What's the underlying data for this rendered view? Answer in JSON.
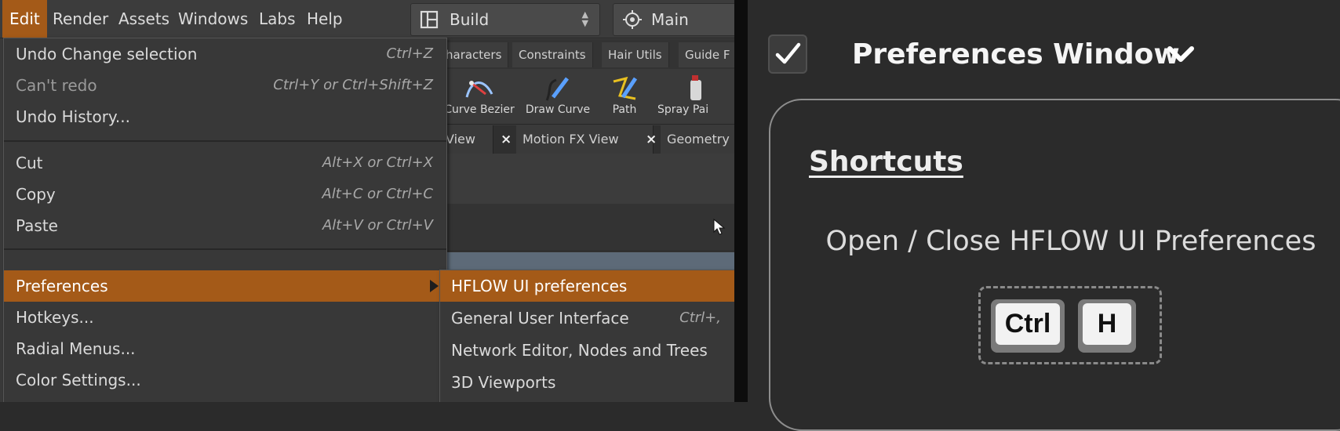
{
  "menubar": {
    "items": [
      "Edit",
      "Render",
      "Assets",
      "Windows",
      "Labs",
      "Help"
    ],
    "active": "Edit"
  },
  "desktop_selector": {
    "value": "Build",
    "icon": "layout-icon"
  },
  "main_button": {
    "label": "Main",
    "icon": "crosshair-icon"
  },
  "shelf_tabs": [
    "haracters",
    "Constraints",
    "Hair Utils",
    "Guide F"
  ],
  "shelf_tools": [
    {
      "label": "Curve Bezier",
      "icon": "curve-bezier-icon"
    },
    {
      "label": "Draw Curve",
      "icon": "draw-curve-icon"
    },
    {
      "label": "Path",
      "icon": "path-icon"
    },
    {
      "label": "Spray Pai",
      "icon": "spray-paint-icon"
    }
  ],
  "pane_tabs": [
    "View",
    "Motion FX View",
    "Geometry"
  ],
  "edit_menu": {
    "items": [
      {
        "label": "Undo Change selection",
        "shortcut": "Ctrl+Z"
      },
      {
        "label": "Can't redo",
        "shortcut": "Ctrl+Y or Ctrl+Shift+Z"
      },
      {
        "label": "Undo History...",
        "shortcut": ""
      },
      {
        "label": "Cut",
        "shortcut": "Alt+X or Ctrl+X"
      },
      {
        "label": "Copy",
        "shortcut": "Alt+C or Ctrl+C"
      },
      {
        "label": "Paste",
        "shortcut": "Alt+V or Ctrl+V"
      },
      {
        "label": "Preferences",
        "shortcut": ""
      },
      {
        "label": "Hotkeys...",
        "shortcut": ""
      },
      {
        "label": "Radial Menus...",
        "shortcut": ""
      },
      {
        "label": "Color Settings...",
        "shortcut": ""
      }
    ],
    "highlighted": "Preferences",
    "disabled": "Can't redo"
  },
  "preferences_submenu": {
    "items": [
      {
        "label": "HFLOW UI preferences",
        "shortcut": ""
      },
      {
        "label": "General User Interface",
        "shortcut": "Ctrl+,"
      },
      {
        "label": "Network Editor, Nodes and Trees",
        "shortcut": ""
      },
      {
        "label": "3D Viewports",
        "shortcut": ""
      }
    ],
    "highlighted": "HFLOW UI preferences"
  },
  "prefs_panel": {
    "checkbox_checked": true,
    "title": "Preferences Window",
    "section_title": "Shortcuts",
    "shortcut_description": "Open / Close HFLOW UI Preferences",
    "keys": [
      "Ctrl",
      "H"
    ]
  },
  "colors": {
    "accent_orange": "#a45a18",
    "menu_bg": "#383838",
    "panel_bg": "#2b2b2b"
  }
}
